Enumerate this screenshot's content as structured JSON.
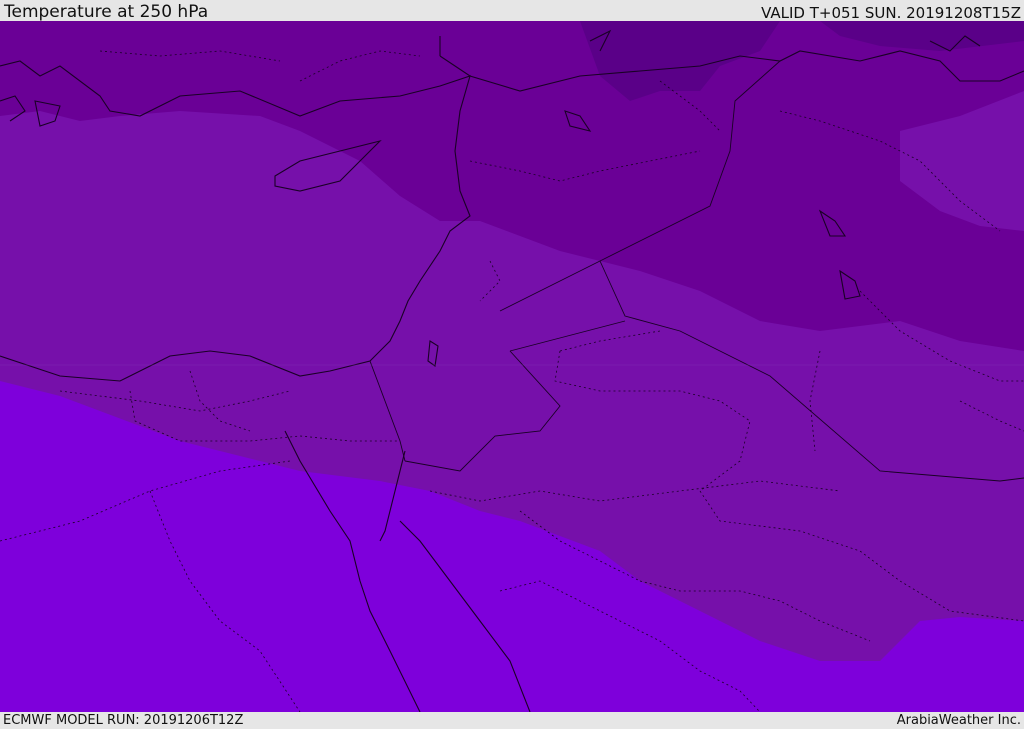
{
  "header": {
    "title": "Temperature at 250 hPa",
    "valid": "VALID T+051 SUN. 20191208T15Z"
  },
  "footer": {
    "model_run": "ECMWF MODEL RUN: 20191206T12Z",
    "credit": "ArabiaWeather Inc."
  },
  "map": {
    "colors": {
      "darkest": "#5a0088",
      "dark": "#6a0096",
      "mid": "#7610aa",
      "light": "#7e00db",
      "border": "#1a0026"
    }
  }
}
